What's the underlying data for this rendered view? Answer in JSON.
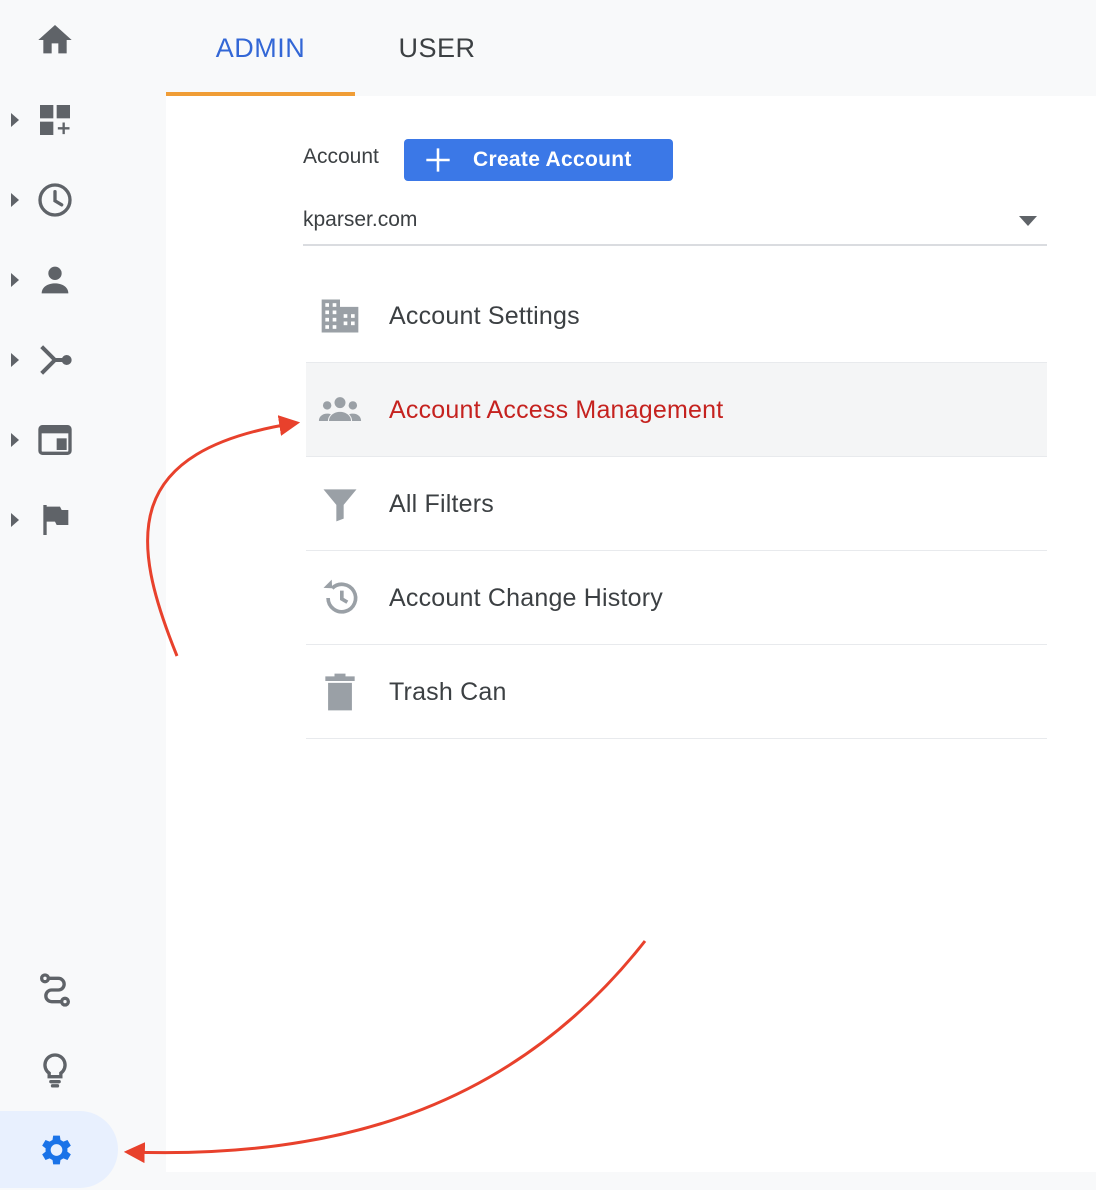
{
  "tabs": [
    {
      "label": "ADMIN",
      "active": true
    },
    {
      "label": "USER",
      "active": false
    }
  ],
  "account": {
    "label": "Account",
    "create_button": "Create Account",
    "selected": "kparser.com"
  },
  "menu": [
    {
      "label": "Account Settings",
      "icon": "building-icon"
    },
    {
      "label": "Account Access Management",
      "icon": "people-icon",
      "active": true
    },
    {
      "label": "All Filters",
      "icon": "filter-icon"
    },
    {
      "label": "Account Change History",
      "icon": "history-icon"
    },
    {
      "label": "Trash Can",
      "icon": "trash-icon"
    }
  ],
  "nav": [
    {
      "icon": "home-icon"
    },
    {
      "icon": "dashboard-add-icon"
    },
    {
      "icon": "clock-icon"
    },
    {
      "icon": "person-icon"
    },
    {
      "icon": "acquisition-icon"
    },
    {
      "icon": "behavior-icon"
    },
    {
      "icon": "flag-icon"
    },
    {
      "icon": "route-icon"
    },
    {
      "icon": "lightbulb-icon"
    },
    {
      "icon": "gear-icon"
    }
  ],
  "colors": {
    "accent_blue": "#3b78e7",
    "tab_active_text": "#3367d6",
    "tab_indicator": "#f09d36",
    "active_item_text": "#c5221f",
    "annotation_arrow": "#e8412c"
  }
}
